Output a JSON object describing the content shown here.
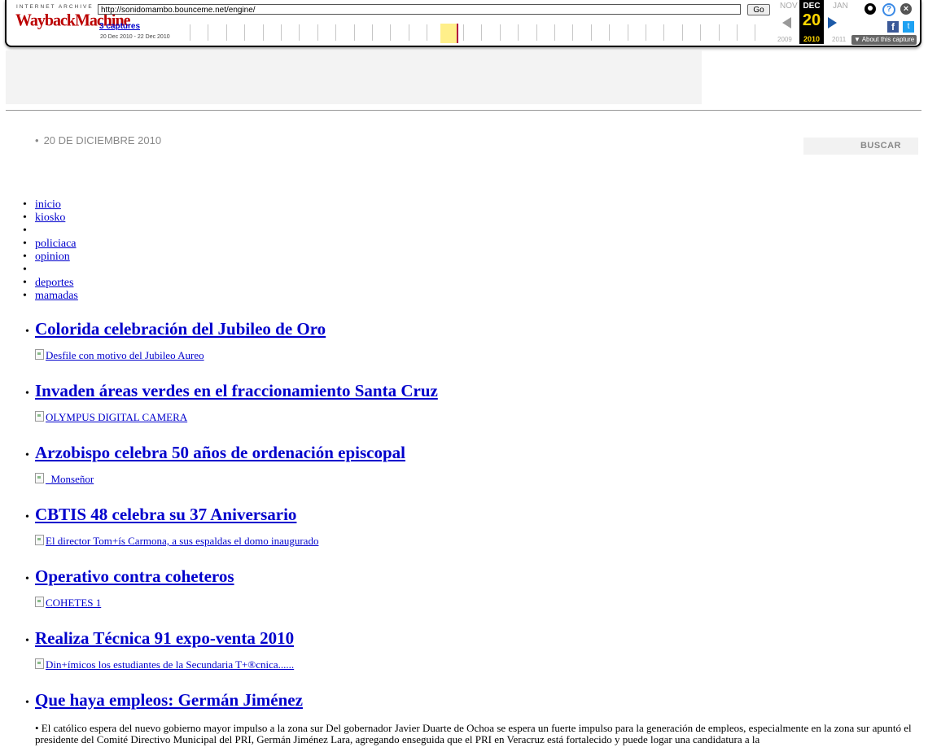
{
  "wayback": {
    "logo_top": "INTERNET ARCHIVE",
    "logo_main": "WaybackMachine",
    "url": "http://sonidomambo.bounceme.net/engine/",
    "go_label": "Go",
    "captures_label": "3 captures",
    "date_range": "20 Dec 2010 - 22 Dec 2010",
    "prev_month": "NOV",
    "cur_month": "DEC",
    "next_month": "JAN",
    "cur_day": "20",
    "prev_year": "2009",
    "cur_year": "2010",
    "next_year": "2011",
    "about_label": "▼ About this capture",
    "facebook_glyph": "f",
    "twitter_glyph": "t"
  },
  "header": {
    "date": "20 DE DICIEMBRE 2010",
    "search_label": "BUSCAR"
  },
  "nav": {
    "items": [
      "inicio",
      "kiosko",
      "",
      "policiaca",
      "opinion",
      "",
      "deportes",
      "mamadas"
    ]
  },
  "posts": [
    {
      "title": "Colorida celebración del Jubileo de Oro",
      "image_alt": "Desfile con motivo del Jubileo Aureo"
    },
    {
      "title": "Invaden áreas verdes en el fraccionamiento Santa Cruz",
      "image_alt": "OLYMPUS DIGITAL CAMERA"
    },
    {
      "title": "Arzobispo celebra 50 años de ordenación episcopal",
      "image_alt": "_Monseñor"
    },
    {
      "title": "CBTIS 48 celebra su 37 Aniversario",
      "image_alt": "El director Tom+ís Carmona, a sus espaldas el domo inaugurado"
    },
    {
      "title": "Operativo contra coheteros",
      "image_alt": "COHETES 1"
    },
    {
      "title": "Realiza Técnica 91 expo-venta 2010",
      "image_alt": "Din+ímicos los estudiantes de la Secundaria T+®cnica......"
    },
    {
      "title": "Que haya empleos: Germán Jiménez",
      "excerpt": "• El católico espera del nuevo gobierno  mayor impulso a la zona sur Del gobernador Javier Duarte de Ochoa se espera un fuerte impulso para la generación de empleos, especialmente en la zona sur apuntó el presidente del Comité Directivo Municipal del PRI, Germán Jiménez Lara, agregando enseguida que el PRI en Veracruz está fortalecido y puede logar una candidatura a la"
    }
  ]
}
